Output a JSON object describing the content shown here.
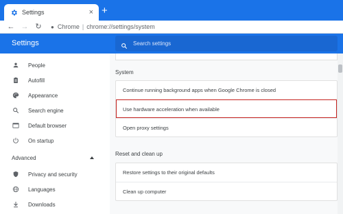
{
  "browser": {
    "tab": {
      "title": "Settings",
      "favicon": "gear-icon",
      "close": "×"
    },
    "new_tab": "+",
    "address": {
      "host": "Chrome",
      "separator": "|",
      "url": "chrome://settings/system"
    }
  },
  "header": {
    "title": "Settings",
    "search_placeholder": "Search settings"
  },
  "sidebar": {
    "items": [
      {
        "label": "People",
        "icon": "person-icon"
      },
      {
        "label": "Autofill",
        "icon": "clipboard-icon"
      },
      {
        "label": "Appearance",
        "icon": "palette-icon"
      },
      {
        "label": "Search engine",
        "icon": "search-icon"
      },
      {
        "label": "Default browser",
        "icon": "browser-icon"
      },
      {
        "label": "On startup",
        "icon": "power-icon"
      }
    ],
    "advanced": "Advanced",
    "advanced_items": [
      {
        "label": "Privacy and security",
        "icon": "shield-icon"
      },
      {
        "label": "Languages",
        "icon": "globe-icon"
      },
      {
        "label": "Downloads",
        "icon": "download-icon"
      }
    ]
  },
  "main": {
    "system": {
      "title": "System",
      "rows": [
        "Continue running background apps when Google Chrome is closed",
        "Use hardware acceleration when available",
        "Open proxy settings"
      ]
    },
    "reset": {
      "title": "Reset and clean up",
      "rows": [
        "Restore settings to their original defaults",
        "Clean up computer"
      ]
    }
  },
  "colors": {
    "accent": "#1a73e8",
    "highlight_border": "#c5221f"
  }
}
